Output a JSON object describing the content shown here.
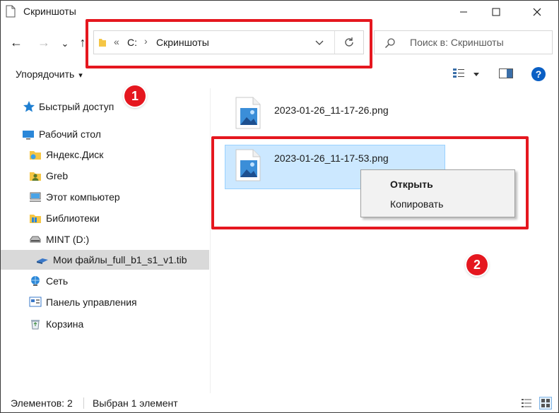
{
  "window": {
    "title": "Скриншоты",
    "caption_buttons": [
      "minimize-button",
      "maximize-button",
      "close-button"
    ]
  },
  "nav": {
    "back_icon": "←",
    "forward_icon": "→",
    "recent_icon": "⌄",
    "up_icon": "↑"
  },
  "address": {
    "overflow": "«",
    "drive": "C:",
    "separator": "›",
    "folder": "Скриншоты"
  },
  "search": {
    "placeholder": "Поиск в: Скриншоты"
  },
  "toolbar": {
    "organize_label": "Упорядочить",
    "organize_arrow": "▾",
    "help_label": "?"
  },
  "sidebar": {
    "items": [
      {
        "label": "Быстрый доступ",
        "icon": "star-icon"
      },
      {
        "label": "Рабочий стол",
        "icon": "desktop-icon"
      },
      {
        "label": "Яндекс.Диск",
        "icon": "yandex-disk-icon"
      },
      {
        "label": "Greb",
        "icon": "user-folder-icon"
      },
      {
        "label": "Этот компьютер",
        "icon": "computer-icon"
      },
      {
        "label": "Библиотеки",
        "icon": "libraries-icon"
      },
      {
        "label": "MINT (D:)",
        "icon": "drive-icon"
      },
      {
        "label": "Мои файлы_full_b1_s1_v1.tib",
        "icon": "tib-file-icon"
      },
      {
        "label": "Сеть",
        "icon": "network-icon"
      },
      {
        "label": "Панель управления",
        "icon": "control-panel-icon"
      },
      {
        "label": "Корзина",
        "icon": "recycle-bin-icon"
      }
    ]
  },
  "files": [
    {
      "name": "2023-01-26_11-17-26.png",
      "selected": false
    },
    {
      "name": "2023-01-26_11-17-53.png",
      "selected": true
    }
  ],
  "context_menu": {
    "items": [
      {
        "label": "Открыть",
        "bold": true
      },
      {
        "label": "Копировать",
        "bold": false
      }
    ]
  },
  "annotations": {
    "badge_1": "1",
    "badge_2": "2",
    "color": "#e5171f"
  },
  "status": {
    "count": "Элементов: 2",
    "selected": "Выбран 1 элемент"
  },
  "colors": {
    "selection_bg": "#cce8ff",
    "selection_border": "#99d1ff",
    "sidebar_selected": "#d9d9d9",
    "accent": "#0078d7"
  }
}
